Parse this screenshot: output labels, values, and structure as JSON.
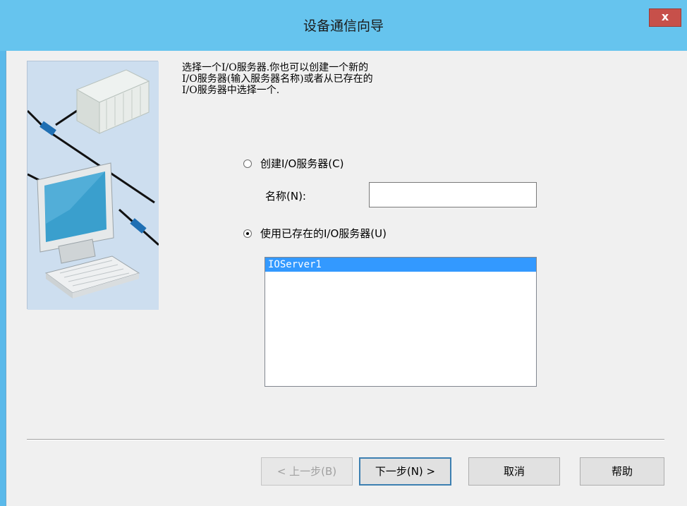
{
  "window": {
    "title": "设备通信向导",
    "close_label": "x"
  },
  "instruction": {
    "line1": "选择一个I/O服务器.你也可以创建一个新的",
    "line2": "I/O服务器(输入服务器名称)或者从已存在的",
    "line3": "I/O服务器中选择一个."
  },
  "options": {
    "create_label": "创建I/O服务器(C)",
    "create_selected": false,
    "name_label": "名称(N):",
    "name_value": "",
    "existing_label": "使用已存在的I/O服务器(U)",
    "existing_selected": true
  },
  "server_list": {
    "items": [
      "IOServer1"
    ],
    "selected_index": 0
  },
  "buttons": {
    "back": "< 上一步(B)",
    "next": "下一步(N) >",
    "cancel": "取消",
    "help": "帮助"
  },
  "illustration": {
    "icons": [
      "plc-rack-icon",
      "network-cable",
      "computer-monitor-icon",
      "keyboard-icon"
    ]
  }
}
